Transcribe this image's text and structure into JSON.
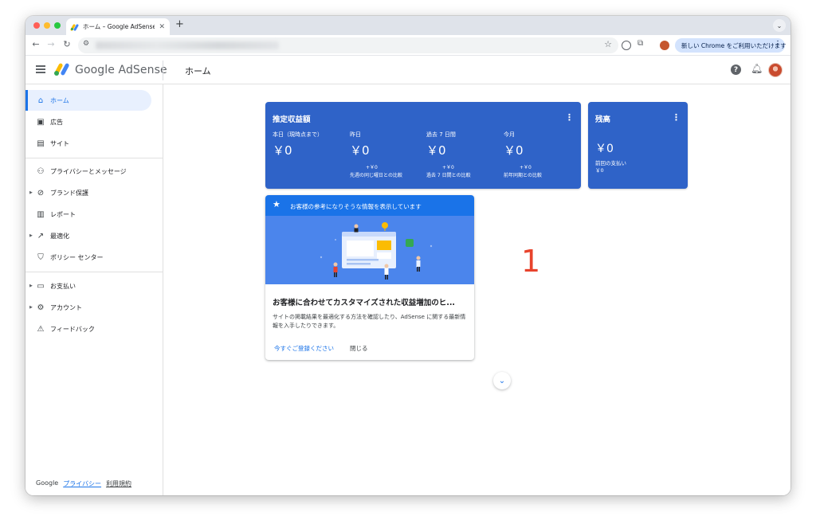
{
  "browser": {
    "tab_title": "ホーム – Google AdSense",
    "new_tab": "+",
    "tab_close": "✕",
    "chrome_pill": "新しい Chrome をご利用いただけます"
  },
  "header": {
    "logo": "Google AdSense",
    "title": "ホーム",
    "help": "?"
  },
  "sidebar": {
    "items": [
      {
        "label": "ホーム",
        "icon": "home-icon"
      },
      {
        "label": "広告",
        "icon": "ads-icon"
      },
      {
        "label": "サイト",
        "icon": "sites-icon"
      },
      {
        "label": "プライバシーとメッセージ",
        "icon": "privacy-icon"
      },
      {
        "label": "ブランド保護",
        "icon": "block-icon"
      },
      {
        "label": "レポート",
        "icon": "report-icon"
      },
      {
        "label": "最適化",
        "icon": "trending-icon"
      },
      {
        "label": "ポリシー センター",
        "icon": "policy-icon"
      },
      {
        "label": "お支払い",
        "icon": "payments-icon"
      },
      {
        "label": "アカウント",
        "icon": "gear-icon"
      },
      {
        "label": "フィードバック",
        "icon": "feedback-icon"
      }
    ],
    "footer": {
      "google": "Google",
      "privacy": "プライバシー",
      "terms": "利用規約"
    }
  },
  "earnings": {
    "title": "推定収益額",
    "columns": [
      {
        "label": "本日（現時点まで）",
        "value": "￥0",
        "cmp_value": "",
        "cmp_label": ""
      },
      {
        "label": "昨日",
        "value": "￥0",
        "cmp_value": "+￥0",
        "cmp_label": "先週の同じ曜日との比較"
      },
      {
        "label": "過去 7 日間",
        "value": "￥0",
        "cmp_value": "+￥0",
        "cmp_label": "過去 7 日間との比較"
      },
      {
        "label": "今月",
        "value": "￥0",
        "cmp_value": "+￥0",
        "cmp_label": "前年同期との比較"
      }
    ]
  },
  "balance": {
    "title": "残高",
    "value": "￥0",
    "prev_label": "前回の支払い",
    "prev_value": "￥0"
  },
  "promo": {
    "header": "お客様の参考になりそうな情報を表示しています",
    "title": "お客様に合わせてカスタマイズされた収益増加のヒ...",
    "body": "サイトの掲載結果を最適化する方法を確認したり、AdSense に関する最新情報を入手したりできます。",
    "signup": "今すぐご登録ください",
    "close": "閉じる"
  },
  "annotation": "1",
  "colors": {
    "accent": "#1a73e8",
    "card_blue": "#2f63c8",
    "annotation_red": "#e8432c"
  }
}
